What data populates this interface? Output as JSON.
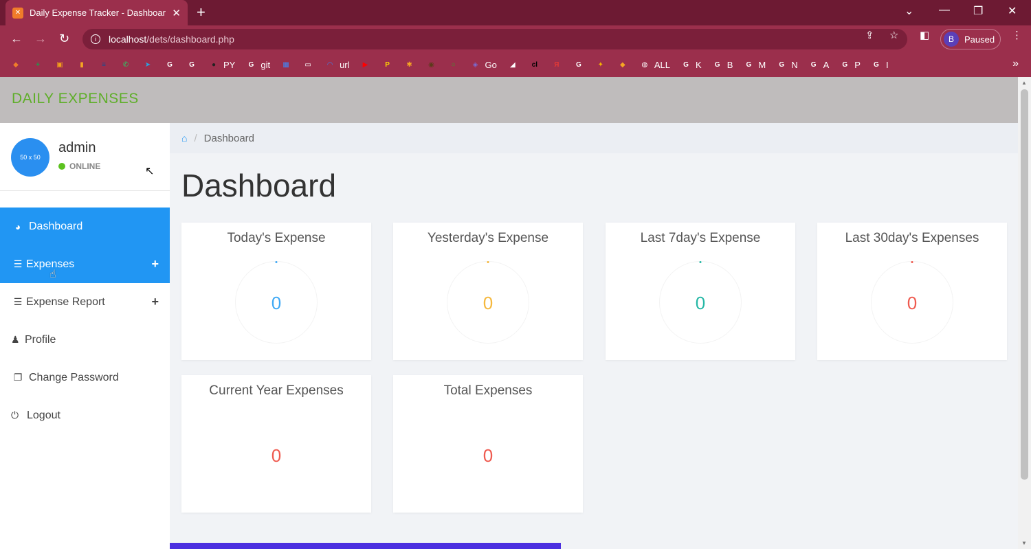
{
  "browser": {
    "tab_title": "Daily Expense Tracker - Dashboar",
    "tab_close": "✕",
    "new_tab": "+",
    "url_host": "localhost",
    "url_path": "/dets/dashboard.php",
    "profile_initial": "B",
    "profile_status": "Paused",
    "bookmarks": [
      {
        "label": "",
        "color": "#f07c2a",
        "glyph": "◆"
      },
      {
        "label": "",
        "color": "#1e9b4c",
        "glyph": "+"
      },
      {
        "label": "",
        "color": "#f4a21a",
        "glyph": "▣"
      },
      {
        "label": "",
        "color": "#f5a623",
        "glyph": "▮"
      },
      {
        "label": "",
        "color": "#1d4b8f",
        "glyph": "≡"
      },
      {
        "label": "",
        "color": "#25d366",
        "glyph": "✆"
      },
      {
        "label": "",
        "color": "#2aa3e0",
        "glyph": "➤"
      },
      {
        "label": "",
        "color": "#ffffff",
        "glyph": "G"
      },
      {
        "label": "",
        "color": "#ffffff",
        "glyph": "G"
      },
      {
        "label": "PY",
        "color": "#222222",
        "glyph": "●"
      },
      {
        "label": "git",
        "color": "#ffffff",
        "glyph": "G"
      },
      {
        "label": "",
        "color": "#4285f4",
        "glyph": "▦"
      },
      {
        "label": "",
        "color": "#ffffff",
        "glyph": "▭"
      },
      {
        "label": "url",
        "color": "#3b82f6",
        "glyph": "◠"
      },
      {
        "label": "",
        "color": "#ff0000",
        "glyph": "▶"
      },
      {
        "label": "",
        "color": "#ffd400",
        "glyph": "P"
      },
      {
        "label": "",
        "color": "#f5a623",
        "glyph": "✱"
      },
      {
        "label": "",
        "color": "#5b3a1a",
        "glyph": "◉"
      },
      {
        "label": "",
        "color": "#3b9a2b",
        "glyph": "○"
      },
      {
        "label": "Go",
        "color": "#7b6bd1",
        "glyph": "◈"
      },
      {
        "label": "",
        "color": "#ffffff",
        "glyph": "◢"
      },
      {
        "label": "",
        "color": "#000000",
        "glyph": "cl"
      },
      {
        "label": "",
        "color": "#e53935",
        "glyph": "Я"
      },
      {
        "label": "",
        "color": "#ffffff",
        "glyph": "G"
      },
      {
        "label": "",
        "color": "#f4b400",
        "glyph": "✦"
      },
      {
        "label": "",
        "color": "#f5a623",
        "glyph": "◆"
      },
      {
        "label": "ALL",
        "color": "#ffffff",
        "glyph": "◍"
      },
      {
        "label": "K",
        "color": "#ffffff",
        "glyph": "G"
      },
      {
        "label": "B",
        "color": "#ffffff",
        "glyph": "G"
      },
      {
        "label": "M",
        "color": "#ffffff",
        "glyph": "G"
      },
      {
        "label": "N",
        "color": "#ffffff",
        "glyph": "G"
      },
      {
        "label": "A",
        "color": "#ffffff",
        "glyph": "G"
      },
      {
        "label": "P",
        "color": "#ffffff",
        "glyph": "G"
      },
      {
        "label": "I",
        "color": "#ffffff",
        "glyph": "G"
      }
    ]
  },
  "app": {
    "brand": "DAILY EXPENSES",
    "user": {
      "avatar_text": "50 x 50",
      "name": "admin",
      "status": "ONLINE"
    },
    "menu": [
      {
        "label": "Dashboard",
        "icon": "dashboard-icon"
      },
      {
        "label": "Expenses",
        "icon": "bars-icon",
        "has_plus": true
      },
      {
        "label": "Expense Report",
        "icon": "bars-icon",
        "has_plus": true
      },
      {
        "label": "Profile",
        "icon": "user-icon"
      },
      {
        "label": "Change Password",
        "icon": "copy-icon"
      },
      {
        "label": "Logout",
        "icon": "power-icon"
      }
    ],
    "breadcrumb": "Dashboard",
    "page_title": "Dashboard",
    "cards": [
      {
        "title": "Today's Expense",
        "value": "0",
        "color": "#3fa9f5"
      },
      {
        "title": "Yesterday's Expense",
        "value": "0",
        "color": "#f5b83d"
      },
      {
        "title": "Last 7day's Expense",
        "value": "0",
        "color": "#26b8a6"
      },
      {
        "title": "Last 30day's Expenses",
        "value": "0",
        "color": "#ef5a4f"
      },
      {
        "title": "Current Year Expenses",
        "value": "0",
        "color": "#ef5a4f"
      },
      {
        "title": "Total Expenses",
        "value": "0",
        "color": "#ef5a4f"
      }
    ]
  },
  "colors": {
    "accent": "#2196f3",
    "brand_green": "#5fae2a",
    "browser_frame": "#9b2f4c",
    "online": "#5cc21f"
  }
}
